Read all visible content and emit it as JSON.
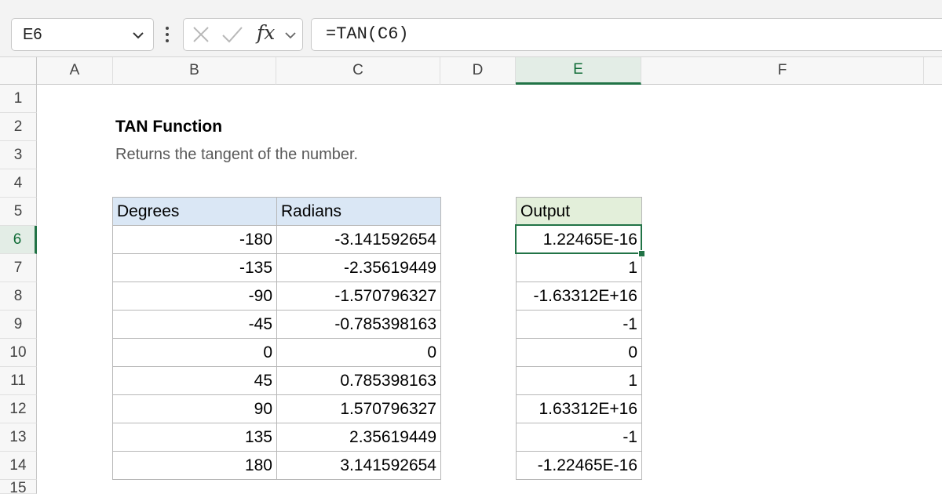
{
  "formula_bar": {
    "name_box": "E6",
    "fx_label": "fx",
    "formula": "=TAN(C6)"
  },
  "columns": [
    "A",
    "B",
    "C",
    "D",
    "E",
    "F"
  ],
  "rows": [
    "1",
    "2",
    "3",
    "4",
    "5",
    "6",
    "7",
    "8",
    "9",
    "10",
    "11",
    "12",
    "13",
    "14",
    "15"
  ],
  "selected_cell": "E6",
  "sheet": {
    "title": "TAN Function",
    "subtitle": "Returns the tangent of the number.",
    "table": {
      "headers": [
        "Degrees",
        "Radians"
      ],
      "rows": [
        [
          "-180",
          "-3.141592654"
        ],
        [
          "-135",
          "-2.35619449"
        ],
        [
          "-90",
          "-1.570796327"
        ],
        [
          "-45",
          "-0.785398163"
        ],
        [
          "0",
          "0"
        ],
        [
          "45",
          "0.785398163"
        ],
        [
          "90",
          "1.570796327"
        ],
        [
          "135",
          "2.35619449"
        ],
        [
          "180",
          "3.141592654"
        ]
      ]
    },
    "output": {
      "header": "Output",
      "values": [
        "1.22465E-16",
        "1",
        "-1.63312E+16",
        "-1",
        "0",
        "1",
        "1.63312E+16",
        "-1",
        "-1.22465E-16"
      ]
    }
  },
  "colors": {
    "selection": "#217346",
    "header_blue": "#dae7f5",
    "header_green": "#e3efda"
  }
}
